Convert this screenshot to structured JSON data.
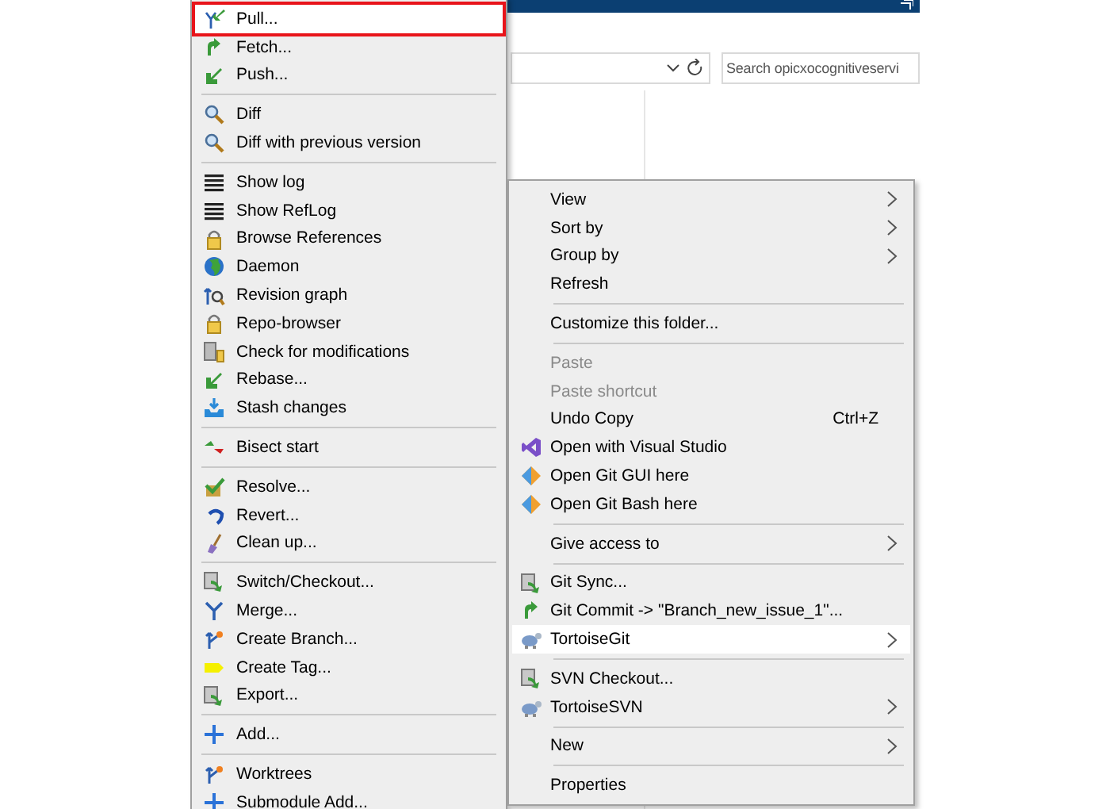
{
  "window": {
    "search": {
      "placeholder": "Search opicxocognitiveservi"
    }
  },
  "git_menu": {
    "items": [
      {
        "kind": "item",
        "label": "Pull...",
        "selected": true,
        "outlined": true
      },
      {
        "kind": "item",
        "label": "Fetch...",
        "selected": false,
        "outlined": false
      },
      {
        "kind": "item",
        "label": "Push...",
        "selected": false,
        "outlined": false
      },
      {
        "kind": "separator"
      },
      {
        "kind": "item",
        "label": "Diff",
        "selected": false,
        "outlined": false
      },
      {
        "kind": "item",
        "label": "Diff with previous version",
        "selected": false,
        "outlined": false
      },
      {
        "kind": "separator"
      },
      {
        "kind": "item",
        "label": "Show log",
        "selected": false,
        "outlined": false
      },
      {
        "kind": "item",
        "label": "Show RefLog",
        "selected": false,
        "outlined": false
      },
      {
        "kind": "item",
        "label": "Browse References",
        "selected": false,
        "outlined": false
      },
      {
        "kind": "item",
        "label": "Daemon",
        "selected": false,
        "outlined": false
      },
      {
        "kind": "item",
        "label": "Revision graph",
        "selected": false,
        "outlined": false
      },
      {
        "kind": "item",
        "label": "Repo-browser",
        "selected": false,
        "outlined": false
      },
      {
        "kind": "item",
        "label": "Check for modifications",
        "selected": false,
        "outlined": false
      },
      {
        "kind": "item",
        "label": "Rebase...",
        "selected": false,
        "outlined": false
      },
      {
        "kind": "item",
        "label": "Stash changes",
        "selected": false,
        "outlined": false
      },
      {
        "kind": "separator"
      },
      {
        "kind": "item",
        "label": "Bisect start",
        "selected": false,
        "outlined": false
      },
      {
        "kind": "separator"
      },
      {
        "kind": "item",
        "label": "Resolve...",
        "selected": false,
        "outlined": false
      },
      {
        "kind": "item",
        "label": "Revert...",
        "selected": false,
        "outlined": false
      },
      {
        "kind": "item",
        "label": "Clean up...",
        "selected": false,
        "outlined": false
      },
      {
        "kind": "separator"
      },
      {
        "kind": "item",
        "label": "Switch/Checkout...",
        "selected": false,
        "outlined": false
      },
      {
        "kind": "item",
        "label": "Merge...",
        "selected": false,
        "outlined": false
      },
      {
        "kind": "item",
        "label": "Create Branch...",
        "selected": false,
        "outlined": false
      },
      {
        "kind": "item",
        "label": "Create Tag...",
        "selected": false,
        "outlined": false
      },
      {
        "kind": "item",
        "label": "Export...",
        "selected": false,
        "outlined": false
      },
      {
        "kind": "separator"
      },
      {
        "kind": "item",
        "label": "Add...",
        "selected": false,
        "outlined": false
      },
      {
        "kind": "separator"
      },
      {
        "kind": "item",
        "label": "Worktrees",
        "selected": false,
        "outlined": false
      },
      {
        "kind": "item",
        "label": "Submodule Add...",
        "selected": false,
        "outlined": false
      }
    ]
  },
  "context_menu": {
    "items": [
      {
        "kind": "item",
        "label": "View",
        "submenu": true,
        "disabled": false,
        "selected": false
      },
      {
        "kind": "item",
        "label": "Sort by",
        "submenu": true,
        "disabled": false,
        "selected": false
      },
      {
        "kind": "item",
        "label": "Group by",
        "submenu": true,
        "disabled": false,
        "selected": false
      },
      {
        "kind": "item",
        "label": "Refresh",
        "submenu": false,
        "disabled": false,
        "selected": false
      },
      {
        "kind": "separator"
      },
      {
        "kind": "item",
        "label": "Customize this folder...",
        "submenu": false,
        "disabled": false,
        "selected": false
      },
      {
        "kind": "separator"
      },
      {
        "kind": "item",
        "label": "Paste",
        "submenu": false,
        "disabled": true,
        "selected": false
      },
      {
        "kind": "item",
        "label": "Paste shortcut",
        "submenu": false,
        "disabled": true,
        "selected": false
      },
      {
        "kind": "item",
        "label": "Undo Copy",
        "shortcut": "Ctrl+Z",
        "submenu": false,
        "disabled": false,
        "selected": false
      },
      {
        "kind": "item",
        "label": "Open with Visual Studio",
        "submenu": false,
        "disabled": false,
        "selected": false
      },
      {
        "kind": "item",
        "label": "Open Git GUI here",
        "submenu": false,
        "disabled": false,
        "selected": false
      },
      {
        "kind": "item",
        "label": "Open Git Bash here",
        "submenu": false,
        "disabled": false,
        "selected": false
      },
      {
        "kind": "separator"
      },
      {
        "kind": "item",
        "label": "Give access to",
        "submenu": true,
        "disabled": false,
        "selected": false
      },
      {
        "kind": "separator"
      },
      {
        "kind": "item",
        "label": "Git Sync...",
        "submenu": false,
        "disabled": false,
        "selected": false
      },
      {
        "kind": "item",
        "label": "Git Commit -> \"Branch_new_issue_1\"...",
        "submenu": false,
        "disabled": false,
        "selected": false
      },
      {
        "kind": "item",
        "label": "TortoiseGit",
        "submenu": true,
        "disabled": false,
        "selected": true
      },
      {
        "kind": "separator"
      },
      {
        "kind": "item",
        "label": "SVN Checkout...",
        "submenu": false,
        "disabled": false,
        "selected": false
      },
      {
        "kind": "item",
        "label": "TortoiseSVN",
        "submenu": true,
        "disabled": false,
        "selected": false
      },
      {
        "kind": "separator"
      },
      {
        "kind": "item",
        "label": "New",
        "submenu": true,
        "disabled": false,
        "selected": false
      },
      {
        "kind": "separator"
      },
      {
        "kind": "item",
        "label": "Properties",
        "submenu": false,
        "disabled": false,
        "selected": false
      }
    ]
  }
}
